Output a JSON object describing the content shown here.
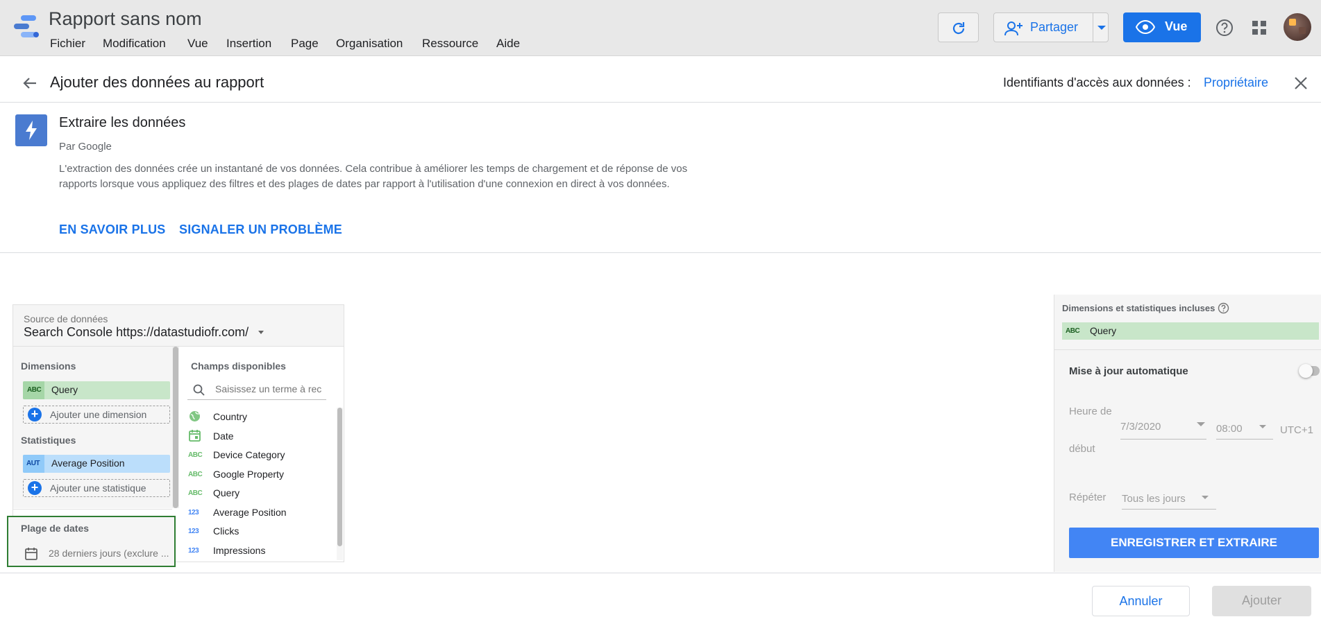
{
  "app": {
    "title": "Rapport sans nom",
    "menu": [
      "Fichier",
      "Modification",
      "Vue",
      "Insertion",
      "Page",
      "Organisation",
      "Ressource",
      "Aide"
    ],
    "share_label": "Partager",
    "view_label": "Vue"
  },
  "panel": {
    "title": "Ajouter des données au rapport",
    "credentials_label": "Identifiants d'accès aux données :",
    "credentials_value": "Propriétaire"
  },
  "connector": {
    "name": "Extraire les données",
    "by": "Par Google",
    "description": "L'extraction des données crée un instantané de vos données. Cela contribue à améliorer les temps de chargement et de réponse de vos rapports lorsque vous appliquez des filtres et des plages de dates par rapport à l'utilisation d'une connexion en direct à vos données.",
    "learn_more": "EN SAVOIR PLUS",
    "report_problem": "SIGNALER UN PROBLÈME"
  },
  "datasource": {
    "label": "Source de données",
    "value": "Search Console https://datastudiofr.com/"
  },
  "config": {
    "dimensions_label": "Dimensions",
    "dimension_items": [
      {
        "type": "ABC",
        "name": "Query"
      }
    ],
    "add_dimension": "Ajouter une dimension",
    "metrics_label": "Statistiques",
    "metric_items": [
      {
        "type": "AUT",
        "name": "Average Position"
      }
    ],
    "add_metric": "Ajouter une statistique",
    "date_range_label": "Plage de dates",
    "date_range_value": "28 derniers jours (exclure ..."
  },
  "available": {
    "label": "Champs disponibles",
    "search_placeholder": "Saisissez un terme à rec",
    "fields": [
      {
        "type": "globe",
        "name": "Country"
      },
      {
        "type": "calendar",
        "name": "Date"
      },
      {
        "type": "ABC",
        "name": "Device Category"
      },
      {
        "type": "ABC",
        "name": "Google Property"
      },
      {
        "type": "ABC",
        "name": "Query"
      },
      {
        "type": "123",
        "name": "Average Position"
      },
      {
        "type": "123",
        "name": "Clicks"
      },
      {
        "type": "123",
        "name": "Impressions"
      }
    ]
  },
  "right": {
    "included_label": "Dimensions et statistiques incluses",
    "included_items": [
      {
        "type": "ABC",
        "name": "Query"
      }
    ],
    "auto_update_label": "Mise à jour automatique",
    "start_time_label_1": "Heure de",
    "start_time_label_2": "début",
    "start_date": "7/3/2020",
    "start_hour": "08:00",
    "timezone": "UTC+1",
    "repeat_label": "Répéter",
    "repeat_value": "Tous les jours",
    "save_extract": "ENREGISTRER ET EXTRAIRE"
  },
  "footer": {
    "cancel": "Annuler",
    "add": "Ajouter"
  },
  "colors": {
    "accent": "#1a73e8",
    "extract_button": "#4285f4",
    "dimension_chip": "#c8e6c9",
    "metric_chip": "#bbdefb",
    "date_range_highlight": "#2e7d32"
  }
}
